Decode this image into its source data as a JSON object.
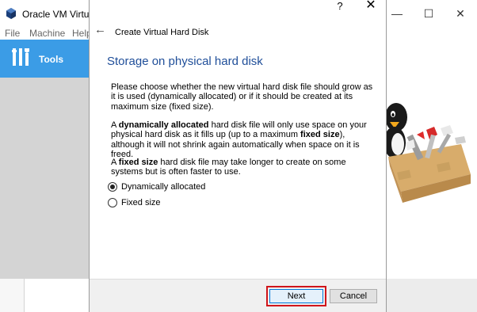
{
  "main_window": {
    "title": "Oracle VM VirtualB",
    "menu": [
      "File",
      "Machine",
      "Help"
    ],
    "tools_label": "Tools",
    "controls": {
      "minimize": "—",
      "maximize": "☐",
      "close": "✕"
    }
  },
  "dialog": {
    "help": "?",
    "close": "✕",
    "back": "←",
    "title": "Create Virtual Hard Disk",
    "heading": "Storage on physical hard disk",
    "para1": "Please choose whether the new virtual hard disk file should grow as it is used (dynamically allocated) or if it should be created at its maximum size (fixed size).",
    "para2": {
      "t1": "A ",
      "b1": "dynamically allocated",
      "t2": " hard disk file will only use space on your physical hard disk as it fills up (up to a maximum ",
      "b2": "fixed size",
      "t3": "), although it will not shrink again automatically when space on it is freed."
    },
    "para3": {
      "t1": "A ",
      "b1": "fixed size",
      "t2": " hard disk file may take longer to create on some systems but is often faster to use."
    },
    "options": [
      {
        "label": "Dynamically allocated",
        "selected": true
      },
      {
        "label": "Fixed size",
        "selected": false
      }
    ],
    "buttons": {
      "next": "Next",
      "cancel": "Cancel"
    },
    "highlight_color": "#d0151b"
  }
}
